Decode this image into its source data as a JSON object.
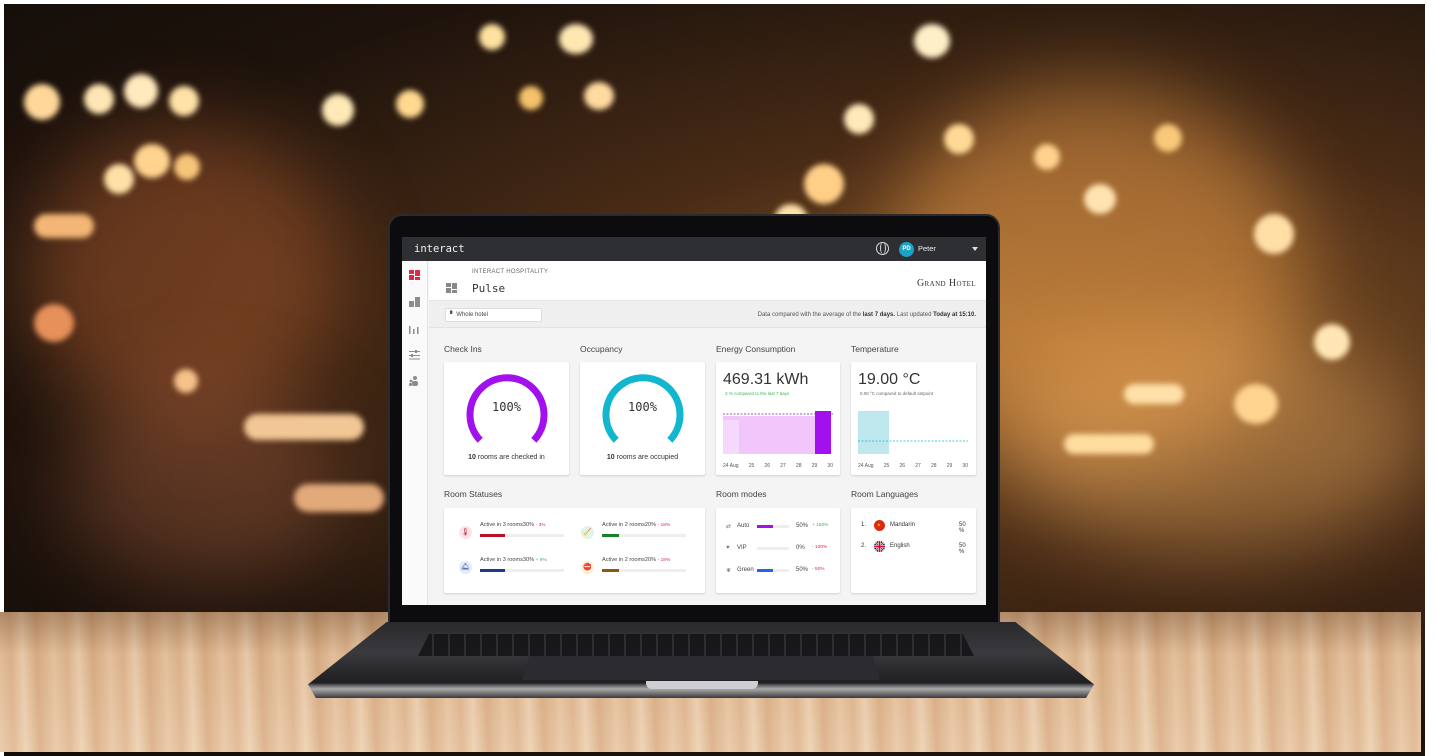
{
  "app": {
    "brand": "interact",
    "user": {
      "initials": "PD",
      "name": "Peter"
    }
  },
  "header": {
    "eyebrow": "INTERACT HOSPITALITY",
    "title": "Pulse",
    "logo": "Grand Hotel"
  },
  "filter": {
    "selected": "Whole hotel",
    "info_prefix": "Data compared with the average of the ",
    "info_period": "last 7 days.",
    "info_mid": " Last updated ",
    "info_updated": "Today at 15:10."
  },
  "sidebar": {
    "items": [
      {
        "name": "dashboard",
        "icon": "dashboard-icon",
        "active": true
      },
      {
        "name": "buildings",
        "icon": "building-icon",
        "active": false
      },
      {
        "name": "reports",
        "icon": "bar-chart-icon",
        "active": false
      },
      {
        "name": "settings",
        "icon": "sliders-icon",
        "active": false
      },
      {
        "name": "users",
        "icon": "users-icon",
        "active": false
      }
    ]
  },
  "check_ins": {
    "title": "Check Ins",
    "value": "100%",
    "percent": 100,
    "caption_count": "10",
    "caption_text": " rooms are checked in",
    "color": "#a310ee"
  },
  "occupancy": {
    "title": "Occupancy",
    "value": "100%",
    "percent": 100,
    "caption_count": "10",
    "caption_text": " rooms are occupied",
    "color": "#13b6cf"
  },
  "energy": {
    "title": "Energy Consumption",
    "value": "469.31 kWh",
    "note": "3 % compared to the last 7 days",
    "note_color": "#3cb55a",
    "x_labels": [
      "24 Aug",
      "25",
      "26",
      "27",
      "28",
      "29",
      "30"
    ]
  },
  "temperature": {
    "title": "Temperature",
    "value": "19.00 °C",
    "note": "0.00 °C compared to default setpoint",
    "note_color": "#666666",
    "x_labels": [
      "24 Aug",
      "25",
      "26",
      "27",
      "28",
      "29",
      "30"
    ]
  },
  "room_statuses": {
    "title": "Room Statuses",
    "items": [
      {
        "text": "Active in 3 rooms",
        "pct": "30%",
        "delta": "- 3%",
        "delta_color": "#e0284a",
        "fill": 0.3,
        "color": "#b3142a",
        "badge_bg": "#fde3e6",
        "icon": "thermometer-icon"
      },
      {
        "text": "Active in 2 rooms",
        "pct": "20%",
        "delta": "- 18%",
        "delta_color": "#e0284a",
        "fill": 0.2,
        "color": "#1a7f2a",
        "badge_bg": "#e0f5e3",
        "icon": "cleaning-icon"
      },
      {
        "text": "Active in 3 rooms",
        "pct": "30%",
        "delta": "+ 9%",
        "delta_color": "#3cb55a",
        "fill": 0.3,
        "color": "#1d3a8a",
        "badge_bg": "#e3ebfb",
        "icon": "service-icon"
      },
      {
        "text": "Active in 2 rooms",
        "pct": "20%",
        "delta": "- 18%",
        "delta_color": "#e0284a",
        "fill": 0.2,
        "color": "#8a5a0e",
        "badge_bg": "#fdf2cf",
        "icon": "do-not-disturb-icon"
      }
    ]
  },
  "room_modes": {
    "title": "Room modes",
    "items": [
      {
        "label": "Auto",
        "pct": "50%",
        "delta": "+ 150%",
        "delta_color": "#3cb55a",
        "fill": 0.5,
        "color": "#a310ee",
        "icon": "auto-icon"
      },
      {
        "label": "VIP",
        "pct": "0%",
        "delta": "- 100%",
        "delta_color": "#e0284a",
        "fill": 0.0,
        "color": "#a310ee",
        "icon": "vip-icon"
      },
      {
        "label": "Green",
        "pct": "50%",
        "delta": "- 50%",
        "delta_color": "#e0284a",
        "fill": 0.5,
        "color": "#2563eb",
        "icon": "leaf-icon"
      }
    ]
  },
  "room_languages": {
    "title": "Room Languages",
    "items": [
      {
        "rank": "1.",
        "name": "Mandarin",
        "pct": "50 %",
        "flag": "china-flag-icon"
      },
      {
        "rank": "2.",
        "name": "English",
        "pct": "50 %",
        "flag": "uk-flag-icon"
      }
    ]
  }
}
